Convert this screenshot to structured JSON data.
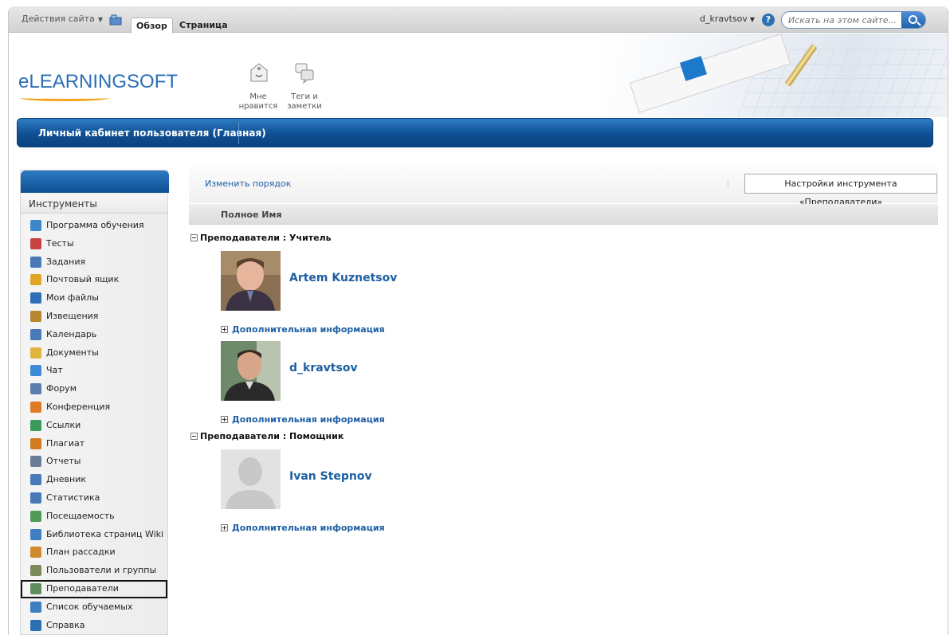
{
  "ribbon": {
    "site_actions": "Действия сайта",
    "tabs": [
      {
        "label": "Обзор",
        "active": true
      },
      {
        "label": "Страница",
        "active": false
      }
    ],
    "user": "d_kravtsov",
    "search_placeholder": "Искать на этом сайте..."
  },
  "header": {
    "logo": "eLEARNINGSOFT",
    "buttons": [
      {
        "label_line1": "Мне",
        "label_line2": "нравится",
        "icon": "thumbs-up-tag-icon"
      },
      {
        "label_line1": "Теги и",
        "label_line2": "заметки",
        "icon": "tags-notes-icon"
      }
    ]
  },
  "titlebar": {
    "title": "Личный кабинет пользователя (Главная)"
  },
  "sidebar": {
    "heading": "Инструменты",
    "items": [
      {
        "label": "Программа обучения",
        "icon": "curriculum-icon",
        "color": "#3b87c9"
      },
      {
        "label": "Тесты",
        "icon": "tests-icon",
        "color": "#c94141"
      },
      {
        "label": "Задания",
        "icon": "assignments-icon",
        "color": "#4a79b8"
      },
      {
        "label": "Почтовый ящик",
        "icon": "mailbox-icon",
        "color": "#e0a526"
      },
      {
        "label": "Мои файлы",
        "icon": "my-files-icon",
        "color": "#2f6fb6"
      },
      {
        "label": "Извещения",
        "icon": "announcements-icon",
        "color": "#b8862e"
      },
      {
        "label": "Календарь",
        "icon": "calendar-icon",
        "color": "#4a79b8"
      },
      {
        "label": "Документы",
        "icon": "documents-icon",
        "color": "#e0b440"
      },
      {
        "label": "Чат",
        "icon": "chat-icon",
        "color": "#3f8ad6"
      },
      {
        "label": "Форум",
        "icon": "forum-icon",
        "color": "#5a7fae"
      },
      {
        "label": "Конференция",
        "icon": "conference-icon",
        "color": "#e07a26"
      },
      {
        "label": "Ссылки",
        "icon": "links-icon",
        "color": "#3a9a5a"
      },
      {
        "label": "Плагиат",
        "icon": "plagiarism-icon",
        "color": "#d47b22"
      },
      {
        "label": "Отчеты",
        "icon": "reports-icon",
        "color": "#6a7f96"
      },
      {
        "label": "Дневник",
        "icon": "diary-icon",
        "color": "#4a79b8"
      },
      {
        "label": "Статистика",
        "icon": "statistics-icon",
        "color": "#4a79b8"
      },
      {
        "label": "Посещаемость",
        "icon": "attendance-icon",
        "color": "#4f9a55"
      },
      {
        "label": "Библиотека страниц Wiki",
        "icon": "wiki-library-icon",
        "color": "#3f7ec2"
      },
      {
        "label": "План рассадки",
        "icon": "seating-plan-icon",
        "color": "#d08a2e"
      },
      {
        "label": "Пользователи и группы",
        "icon": "users-groups-icon",
        "color": "#7a8a5a"
      },
      {
        "label": "Преподаватели",
        "icon": "teachers-icon",
        "color": "#5f8f5f",
        "selected": true
      },
      {
        "label": "Список обучаемых",
        "icon": "learners-list-icon",
        "color": "#3f7ec2"
      },
      {
        "label": "Справка",
        "icon": "help-icon",
        "color": "#2d6fb3"
      }
    ]
  },
  "main": {
    "reorder": "Изменить порядок",
    "settings": "Настройки инструмента «Преподаватели»",
    "column": "Полное Имя",
    "more_info": "Дополнительная информация",
    "groups": [
      {
        "title": "Преподаватели : Учитель",
        "people": [
          {
            "name": "Artem Kuznetsov",
            "photo": "person-photo-artem"
          },
          {
            "name": "d_kravtsov",
            "photo": "person-photo-dkravtsov"
          }
        ]
      },
      {
        "title": "Преподаватели : Помощник",
        "people": [
          {
            "name": "Ivan Stepnov",
            "photo": "default-avatar-placeholder"
          }
        ]
      }
    ]
  }
}
